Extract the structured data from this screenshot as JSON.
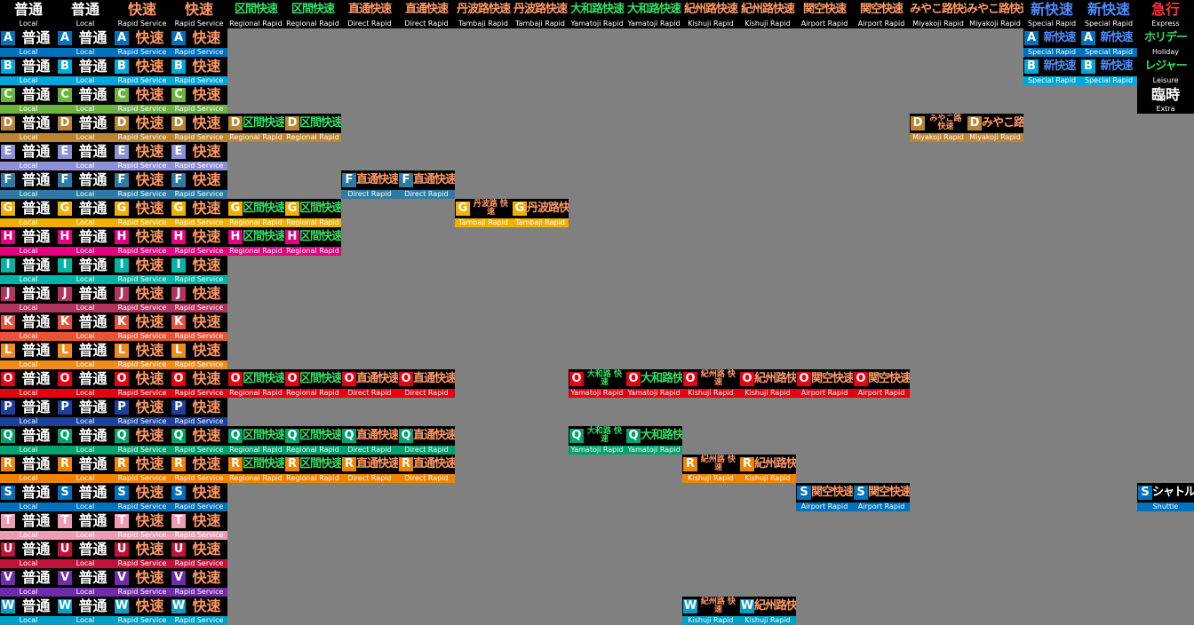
{
  "groups": {
    "local": {
      "name": "普通",
      "sub": "Local",
      "color": "#ffffff"
    },
    "rapid_service": {
      "name": "快速",
      "sub": "Rapid Service",
      "color": "#ff9966"
    },
    "regional": {
      "name": "区間快速",
      "sub": "Regional Rapid",
      "color": "#33dd66"
    },
    "direct": {
      "name": "直通快速",
      "sub": "Direct Rapid",
      "color": "#ff9966"
    },
    "tambaji": {
      "name": "丹波路快速",
      "name_stacked": "丹波路 快速",
      "sub": "Tambaji Rapid",
      "color": "#ff9966"
    },
    "yamatoji": {
      "name": "大和路快速",
      "name_stacked": "大和路 快速",
      "sub": "Yamatoji Rapid",
      "color": "#33dd66"
    },
    "kishuji": {
      "name": "紀州路快速",
      "name_stacked": "紀州路 快速",
      "sub": "Kishuji Rapid",
      "color": "#ff9966"
    },
    "airport": {
      "name": "関空快速",
      "sub": "Airport Rapid",
      "color": "#ff9966"
    },
    "miyakoji": {
      "name": "みやこ路快速",
      "name_stacked": "みやこ路 快速",
      "sub": "Miyakoji Rapid",
      "color": "#ff9966"
    },
    "special": {
      "name": "新快速",
      "sub": "Special Rapid",
      "color": "#4d8cff"
    },
    "express": {
      "name": "急行",
      "sub": "Express",
      "color": "#ff3333"
    },
    "holiday": {
      "name": "ホリデー",
      "sub": "Holiday",
      "color": "#33dd66"
    },
    "leisure": {
      "name": "レジャー",
      "sub": "Leisure",
      "color": "#33dd66"
    },
    "extra": {
      "name": "臨時",
      "sub": "Extra",
      "color": "#ffffff"
    },
    "shuttle": {
      "name": "シャトル",
      "sub": "Shuttle",
      "color": "#ffffff"
    }
  },
  "lines": {
    "A": {
      "color": "#0072bc"
    },
    "B": {
      "color": "#00a7db"
    },
    "C": {
      "color": "#6ab43f"
    },
    "D": {
      "color": "#b8862f"
    },
    "E": {
      "color": "#8f8fd8"
    },
    "F": {
      "color": "#2e7aa3"
    },
    "G": {
      "color": "#f0b000"
    },
    "H": {
      "color": "#e6007e"
    },
    "I": {
      "color": "#00b5a6"
    },
    "J": {
      "color": "#b0345e"
    },
    "K": {
      "color": "#e6533a"
    },
    "L": {
      "color": "#f18c1c"
    },
    "O": {
      "color": "#e60012"
    },
    "P": {
      "color": "#1e3f9c"
    },
    "Q": {
      "color": "#00a26e"
    },
    "R": {
      "color": "#f08300"
    },
    "S": {
      "color": "#0071bc"
    },
    "T": {
      "color": "#f29bb5"
    },
    "U": {
      "color": "#c1123a"
    },
    "V": {
      "color": "#6f2ca6"
    },
    "W": {
      "color": "#00a0c6"
    }
  },
  "cells": [
    {
      "c": 0,
      "r": 0,
      "g": "local"
    },
    {
      "c": 1,
      "r": 0,
      "g": "local"
    },
    {
      "c": 2,
      "r": 0,
      "g": "rapid_service"
    },
    {
      "c": 3,
      "r": 0,
      "g": "rapid_service"
    },
    {
      "c": 4,
      "r": 0,
      "g": "regional"
    },
    {
      "c": 5,
      "r": 0,
      "g": "regional"
    },
    {
      "c": 6,
      "r": 0,
      "g": "direct"
    },
    {
      "c": 7,
      "r": 0,
      "g": "direct"
    },
    {
      "c": 8,
      "r": 0,
      "g": "tambaji"
    },
    {
      "c": 9,
      "r": 0,
      "g": "tambaji"
    },
    {
      "c": 10,
      "r": 0,
      "g": "yamatoji"
    },
    {
      "c": 11,
      "r": 0,
      "g": "yamatoji"
    },
    {
      "c": 12,
      "r": 0,
      "g": "kishuji"
    },
    {
      "c": 13,
      "r": 0,
      "g": "kishuji"
    },
    {
      "c": 14,
      "r": 0,
      "g": "airport"
    },
    {
      "c": 15,
      "r": 0,
      "g": "airport"
    },
    {
      "c": 16,
      "r": 0,
      "g": "miyakoji"
    },
    {
      "c": 17,
      "r": 0,
      "g": "miyakoji"
    },
    {
      "c": 18,
      "r": 0,
      "g": "special"
    },
    {
      "c": 19,
      "r": 0,
      "g": "special"
    },
    {
      "c": 20,
      "r": 0,
      "g": "express"
    },
    {
      "c": 0,
      "r": 1,
      "g": "local",
      "l": "A"
    },
    {
      "c": 1,
      "r": 1,
      "g": "local",
      "l": "A"
    },
    {
      "c": 2,
      "r": 1,
      "g": "rapid_service",
      "l": "A"
    },
    {
      "c": 3,
      "r": 1,
      "g": "rapid_service",
      "l": "A"
    },
    {
      "c": 18,
      "r": 1,
      "g": "special",
      "l": "A"
    },
    {
      "c": 19,
      "r": 1,
      "g": "special",
      "l": "A"
    },
    {
      "c": 20,
      "r": 1,
      "g": "holiday"
    },
    {
      "c": 0,
      "r": 2,
      "g": "local",
      "l": "B"
    },
    {
      "c": 1,
      "r": 2,
      "g": "local",
      "l": "B"
    },
    {
      "c": 2,
      "r": 2,
      "g": "rapid_service",
      "l": "B"
    },
    {
      "c": 3,
      "r": 2,
      "g": "rapid_service",
      "l": "B"
    },
    {
      "c": 18,
      "r": 2,
      "g": "special",
      "l": "B"
    },
    {
      "c": 19,
      "r": 2,
      "g": "special",
      "l": "B"
    },
    {
      "c": 20,
      "r": 2,
      "g": "leisure"
    },
    {
      "c": 0,
      "r": 3,
      "g": "local",
      "l": "C"
    },
    {
      "c": 1,
      "r": 3,
      "g": "local",
      "l": "C"
    },
    {
      "c": 2,
      "r": 3,
      "g": "rapid_service",
      "l": "C"
    },
    {
      "c": 3,
      "r": 3,
      "g": "rapid_service",
      "l": "C"
    },
    {
      "c": 20,
      "r": 3,
      "g": "extra"
    },
    {
      "c": 0,
      "r": 4,
      "g": "local",
      "l": "D"
    },
    {
      "c": 1,
      "r": 4,
      "g": "local",
      "l": "D"
    },
    {
      "c": 2,
      "r": 4,
      "g": "rapid_service",
      "l": "D"
    },
    {
      "c": 3,
      "r": 4,
      "g": "rapid_service",
      "l": "D"
    },
    {
      "c": 4,
      "r": 4,
      "g": "regional",
      "l": "D"
    },
    {
      "c": 5,
      "r": 4,
      "g": "regional",
      "l": "D"
    },
    {
      "c": 16,
      "r": 4,
      "g": "miyakoji",
      "l": "D"
    },
    {
      "c": 17,
      "r": 4,
      "g": "miyakoji",
      "l": "D"
    },
    {
      "c": 0,
      "r": 5,
      "g": "local",
      "l": "E"
    },
    {
      "c": 1,
      "r": 5,
      "g": "local",
      "l": "E"
    },
    {
      "c": 2,
      "r": 5,
      "g": "rapid_service",
      "l": "E"
    },
    {
      "c": 3,
      "r": 5,
      "g": "rapid_service",
      "l": "E"
    },
    {
      "c": 0,
      "r": 6,
      "g": "local",
      "l": "F"
    },
    {
      "c": 1,
      "r": 6,
      "g": "local",
      "l": "F"
    },
    {
      "c": 2,
      "r": 6,
      "g": "rapid_service",
      "l": "F"
    },
    {
      "c": 3,
      "r": 6,
      "g": "rapid_service",
      "l": "F"
    },
    {
      "c": 6,
      "r": 6,
      "g": "direct",
      "l": "F"
    },
    {
      "c": 7,
      "r": 6,
      "g": "direct",
      "l": "F"
    },
    {
      "c": 0,
      "r": 7,
      "g": "local",
      "l": "G"
    },
    {
      "c": 1,
      "r": 7,
      "g": "local",
      "l": "G"
    },
    {
      "c": 2,
      "r": 7,
      "g": "rapid_service",
      "l": "G"
    },
    {
      "c": 3,
      "r": 7,
      "g": "rapid_service",
      "l": "G"
    },
    {
      "c": 4,
      "r": 7,
      "g": "regional",
      "l": "G"
    },
    {
      "c": 5,
      "r": 7,
      "g": "regional",
      "l": "G"
    },
    {
      "c": 8,
      "r": 7,
      "g": "tambaji",
      "l": "G"
    },
    {
      "c": 9,
      "r": 7,
      "g": "tambaji",
      "l": "G"
    },
    {
      "c": 0,
      "r": 8,
      "g": "local",
      "l": "H"
    },
    {
      "c": 1,
      "r": 8,
      "g": "local",
      "l": "H"
    },
    {
      "c": 2,
      "r": 8,
      "g": "rapid_service",
      "l": "H"
    },
    {
      "c": 3,
      "r": 8,
      "g": "rapid_service",
      "l": "H"
    },
    {
      "c": 4,
      "r": 8,
      "g": "regional",
      "l": "H"
    },
    {
      "c": 5,
      "r": 8,
      "g": "regional",
      "l": "H"
    },
    {
      "c": 0,
      "r": 9,
      "g": "local",
      "l": "I"
    },
    {
      "c": 1,
      "r": 9,
      "g": "local",
      "l": "I"
    },
    {
      "c": 2,
      "r": 9,
      "g": "rapid_service",
      "l": "I"
    },
    {
      "c": 3,
      "r": 9,
      "g": "rapid_service",
      "l": "I"
    },
    {
      "c": 0,
      "r": 10,
      "g": "local",
      "l": "J"
    },
    {
      "c": 1,
      "r": 10,
      "g": "local",
      "l": "J"
    },
    {
      "c": 2,
      "r": 10,
      "g": "rapid_service",
      "l": "J"
    },
    {
      "c": 3,
      "r": 10,
      "g": "rapid_service",
      "l": "J"
    },
    {
      "c": 0,
      "r": 11,
      "g": "local",
      "l": "K"
    },
    {
      "c": 1,
      "r": 11,
      "g": "local",
      "l": "K"
    },
    {
      "c": 2,
      "r": 11,
      "g": "rapid_service",
      "l": "K"
    },
    {
      "c": 3,
      "r": 11,
      "g": "rapid_service",
      "l": "K"
    },
    {
      "c": 0,
      "r": 12,
      "g": "local",
      "l": "L"
    },
    {
      "c": 1,
      "r": 12,
      "g": "local",
      "l": "L"
    },
    {
      "c": 2,
      "r": 12,
      "g": "rapid_service",
      "l": "L"
    },
    {
      "c": 3,
      "r": 12,
      "g": "rapid_service",
      "l": "L"
    },
    {
      "c": 0,
      "r": 13,
      "g": "local",
      "l": "O"
    },
    {
      "c": 1,
      "r": 13,
      "g": "local",
      "l": "O"
    },
    {
      "c": 2,
      "r": 13,
      "g": "rapid_service",
      "l": "O"
    },
    {
      "c": 3,
      "r": 13,
      "g": "rapid_service",
      "l": "O"
    },
    {
      "c": 4,
      "r": 13,
      "g": "regional",
      "l": "O"
    },
    {
      "c": 5,
      "r": 13,
      "g": "regional",
      "l": "O"
    },
    {
      "c": 6,
      "r": 13,
      "g": "direct",
      "l": "O"
    },
    {
      "c": 7,
      "r": 13,
      "g": "direct",
      "l": "O"
    },
    {
      "c": 10,
      "r": 13,
      "g": "yamatoji",
      "l": "O"
    },
    {
      "c": 11,
      "r": 13,
      "g": "yamatoji",
      "l": "O"
    },
    {
      "c": 12,
      "r": 13,
      "g": "kishuji",
      "l": "O"
    },
    {
      "c": 13,
      "r": 13,
      "g": "kishuji",
      "l": "O"
    },
    {
      "c": 14,
      "r": 13,
      "g": "airport",
      "l": "O"
    },
    {
      "c": 15,
      "r": 13,
      "g": "airport",
      "l": "O"
    },
    {
      "c": 0,
      "r": 14,
      "g": "local",
      "l": "P"
    },
    {
      "c": 1,
      "r": 14,
      "g": "local",
      "l": "P"
    },
    {
      "c": 2,
      "r": 14,
      "g": "rapid_service",
      "l": "P"
    },
    {
      "c": 3,
      "r": 14,
      "g": "rapid_service",
      "l": "P"
    },
    {
      "c": 0,
      "r": 15,
      "g": "local",
      "l": "Q"
    },
    {
      "c": 1,
      "r": 15,
      "g": "local",
      "l": "Q"
    },
    {
      "c": 2,
      "r": 15,
      "g": "rapid_service",
      "l": "Q"
    },
    {
      "c": 3,
      "r": 15,
      "g": "rapid_service",
      "l": "Q"
    },
    {
      "c": 4,
      "r": 15,
      "g": "regional",
      "l": "Q"
    },
    {
      "c": 5,
      "r": 15,
      "g": "regional",
      "l": "Q"
    },
    {
      "c": 6,
      "r": 15,
      "g": "direct",
      "l": "Q"
    },
    {
      "c": 7,
      "r": 15,
      "g": "direct",
      "l": "Q"
    },
    {
      "c": 10,
      "r": 15,
      "g": "yamatoji",
      "l": "Q"
    },
    {
      "c": 11,
      "r": 15,
      "g": "yamatoji",
      "l": "Q"
    },
    {
      "c": 0,
      "r": 16,
      "g": "local",
      "l": "R"
    },
    {
      "c": 1,
      "r": 16,
      "g": "local",
      "l": "R"
    },
    {
      "c": 2,
      "r": 16,
      "g": "rapid_service",
      "l": "R"
    },
    {
      "c": 3,
      "r": 16,
      "g": "rapid_service",
      "l": "R"
    },
    {
      "c": 4,
      "r": 16,
      "g": "regional",
      "l": "R"
    },
    {
      "c": 5,
      "r": 16,
      "g": "regional",
      "l": "R"
    },
    {
      "c": 6,
      "r": 16,
      "g": "direct",
      "l": "R"
    },
    {
      "c": 7,
      "r": 16,
      "g": "direct",
      "l": "R"
    },
    {
      "c": 12,
      "r": 16,
      "g": "kishuji",
      "l": "R"
    },
    {
      "c": 13,
      "r": 16,
      "g": "kishuji",
      "l": "R"
    },
    {
      "c": 0,
      "r": 17,
      "g": "local",
      "l": "S"
    },
    {
      "c": 1,
      "r": 17,
      "g": "local",
      "l": "S"
    },
    {
      "c": 2,
      "r": 17,
      "g": "rapid_service",
      "l": "S"
    },
    {
      "c": 3,
      "r": 17,
      "g": "rapid_service",
      "l": "S"
    },
    {
      "c": 14,
      "r": 17,
      "g": "airport",
      "l": "S"
    },
    {
      "c": 15,
      "r": 17,
      "g": "airport",
      "l": "S"
    },
    {
      "c": 20,
      "r": 17,
      "g": "shuttle",
      "l": "S"
    },
    {
      "c": 0,
      "r": 18,
      "g": "local",
      "l": "T"
    },
    {
      "c": 1,
      "r": 18,
      "g": "local",
      "l": "T"
    },
    {
      "c": 2,
      "r": 18,
      "g": "rapid_service",
      "l": "T"
    },
    {
      "c": 3,
      "r": 18,
      "g": "rapid_service",
      "l": "T"
    },
    {
      "c": 0,
      "r": 19,
      "g": "local",
      "l": "U"
    },
    {
      "c": 1,
      "r": 19,
      "g": "local",
      "l": "U"
    },
    {
      "c": 2,
      "r": 19,
      "g": "rapid_service",
      "l": "U"
    },
    {
      "c": 3,
      "r": 19,
      "g": "rapid_service",
      "l": "U"
    },
    {
      "c": 0,
      "r": 20,
      "g": "local",
      "l": "V"
    },
    {
      "c": 1,
      "r": 20,
      "g": "local",
      "l": "V"
    },
    {
      "c": 2,
      "r": 20,
      "g": "rapid_service",
      "l": "V"
    },
    {
      "c": 3,
      "r": 20,
      "g": "rapid_service",
      "l": "V"
    },
    {
      "c": 0,
      "r": 21,
      "g": "local",
      "l": "W"
    },
    {
      "c": 1,
      "r": 21,
      "g": "local",
      "l": "W"
    },
    {
      "c": 2,
      "r": 21,
      "g": "rapid_service",
      "l": "W"
    },
    {
      "c": 3,
      "r": 21,
      "g": "rapid_service",
      "l": "W"
    },
    {
      "c": 12,
      "r": 21,
      "g": "kishuji",
      "l": "W"
    },
    {
      "c": 13,
      "r": 21,
      "g": "kishuji",
      "l": "W"
    }
  ]
}
